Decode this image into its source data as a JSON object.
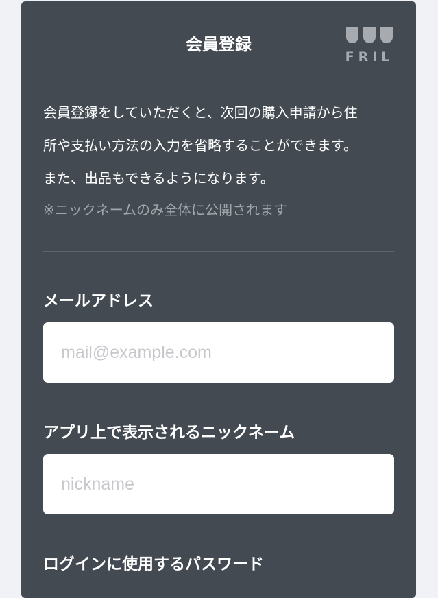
{
  "header": {
    "title": "会員登録",
    "logo_text": "FRIL"
  },
  "intro": {
    "lines": [
      "会員登録をしていただくと、次回の購入申請から住",
      "所や支払い方法の入力を省略することができます。",
      "また、出品もできるようになります。"
    ],
    "note": "※ニックネームのみ全体に公開されます"
  },
  "form": {
    "email": {
      "label": "メールアドレス",
      "placeholder": "mail@example.com",
      "value": ""
    },
    "nickname": {
      "label": "アプリ上で表示されるニックネーム",
      "placeholder": "nickname",
      "value": ""
    },
    "password": {
      "label": "ログインに使用するパスワード"
    }
  },
  "colors": {
    "page_bg": "#f1f2f6",
    "card_bg": "#434a51",
    "muted_text": "#a2a7ac",
    "logo": "#a7abb0"
  }
}
